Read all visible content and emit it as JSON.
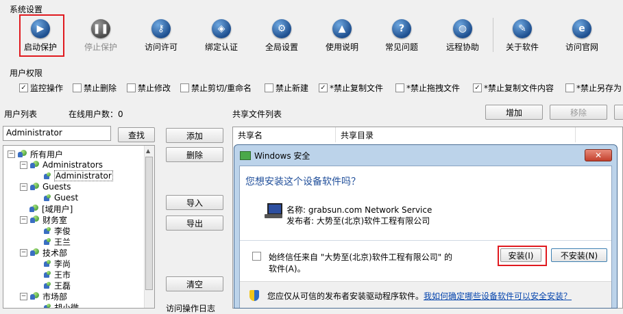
{
  "window": {
    "section_system": "系统设置",
    "section_user_perm": "用户权限"
  },
  "toolbar": [
    {
      "label": "启动保护",
      "icon": "play-icon",
      "glyph": "▶",
      "disabled": false
    },
    {
      "label": "停止保护",
      "icon": "pause-icon",
      "glyph": "❚❚",
      "disabled": true
    },
    {
      "label": "访问许可",
      "icon": "key-icon",
      "glyph": "⚷",
      "disabled": false
    },
    {
      "label": "绑定认证",
      "icon": "shield-icon",
      "glyph": "◈",
      "disabled": false
    },
    {
      "label": "全局设置",
      "icon": "gear-icon",
      "glyph": "⚙",
      "disabled": false
    },
    {
      "label": "使用说明",
      "icon": "graduation-cap-icon",
      "glyph": "▲",
      "disabled": false
    },
    {
      "label": "常见问题",
      "icon": "question-icon",
      "glyph": "?",
      "disabled": false
    },
    {
      "label": "远程协助",
      "icon": "globe-icon",
      "glyph": "◍",
      "disabled": false
    },
    {
      "label": "关于软件",
      "icon": "notepad-icon",
      "glyph": "✎",
      "disabled": false
    },
    {
      "label": "访问官网",
      "icon": "ie-icon",
      "glyph": "e",
      "disabled": false
    }
  ],
  "permissions": [
    {
      "label": "监控操作",
      "checked": true
    },
    {
      "label": "禁止删除",
      "checked": false
    },
    {
      "label": "禁止修改",
      "checked": false
    },
    {
      "label": "禁止剪切/重命名",
      "checked": false
    },
    {
      "label": "禁止新建",
      "checked": false
    },
    {
      "label": "*禁止复制文件",
      "checked": true
    },
    {
      "label": "*禁止拖拽文件",
      "checked": false
    },
    {
      "label": "*禁止复制文件内容",
      "checked": true
    },
    {
      "label": "*禁止另存为",
      "checked": false
    }
  ],
  "user_list": {
    "title": "用户列表",
    "online_label": "在线用户数：0",
    "search_value": "Administrator",
    "search_button": "查找",
    "tree": [
      {
        "label": "所有用户",
        "level": 0,
        "expander": "−",
        "type": "group"
      },
      {
        "label": "Administrators",
        "level": 1,
        "expander": "−",
        "type": "group"
      },
      {
        "label": "Administrator",
        "level": 2,
        "expander": "",
        "type": "user",
        "selected": true
      },
      {
        "label": "Guests",
        "level": 1,
        "expander": "−",
        "type": "group"
      },
      {
        "label": "Guest",
        "level": 2,
        "expander": "",
        "type": "user"
      },
      {
        "label": "[域用户]",
        "level": 1,
        "expander": "",
        "type": "group"
      },
      {
        "label": "财务室",
        "level": 1,
        "expander": "−",
        "type": "group"
      },
      {
        "label": "李俊",
        "level": 2,
        "expander": "",
        "type": "user"
      },
      {
        "label": "王兰",
        "level": 2,
        "expander": "",
        "type": "user"
      },
      {
        "label": "技术部",
        "level": 1,
        "expander": "−",
        "type": "group"
      },
      {
        "label": "李尚",
        "level": 2,
        "expander": "",
        "type": "user"
      },
      {
        "label": "王市",
        "level": 2,
        "expander": "",
        "type": "user"
      },
      {
        "label": "王磊",
        "level": 2,
        "expander": "",
        "type": "user"
      },
      {
        "label": "市场部",
        "level": 1,
        "expander": "−",
        "type": "group"
      },
      {
        "label": "胡小微",
        "level": 2,
        "expander": "",
        "type": "user"
      }
    ]
  },
  "middle_buttons": {
    "add": "添加",
    "delete": "删除",
    "import": "导入",
    "export": "导出",
    "clear": "清空",
    "log_label": "访问操作日志"
  },
  "share_list": {
    "title": "共享文件列表",
    "add_button": "增加",
    "remove_button": "移除",
    "columns": [
      "共享名",
      "共享目录"
    ]
  },
  "dialog": {
    "title": "Windows 安全",
    "close_glyph": "✕",
    "question": "您想安装这个设备软件吗？",
    "name_line": "名称: grabsun.com Network Service",
    "publisher_line": "发布者: 大势至(北京)软件工程有限公司",
    "always_trust": "始终信任来自 \"大势至(北京)软件工程有限公司\" 的",
    "always_trust_2": "软件(A)。",
    "install_button": "安装(I)",
    "dont_install_button": "不安装(N)",
    "footer_text": "您应仅从可信的发布者安装驱动程序软件。",
    "footer_link": "我如何确定哪些设备软件可以安全安装？"
  }
}
